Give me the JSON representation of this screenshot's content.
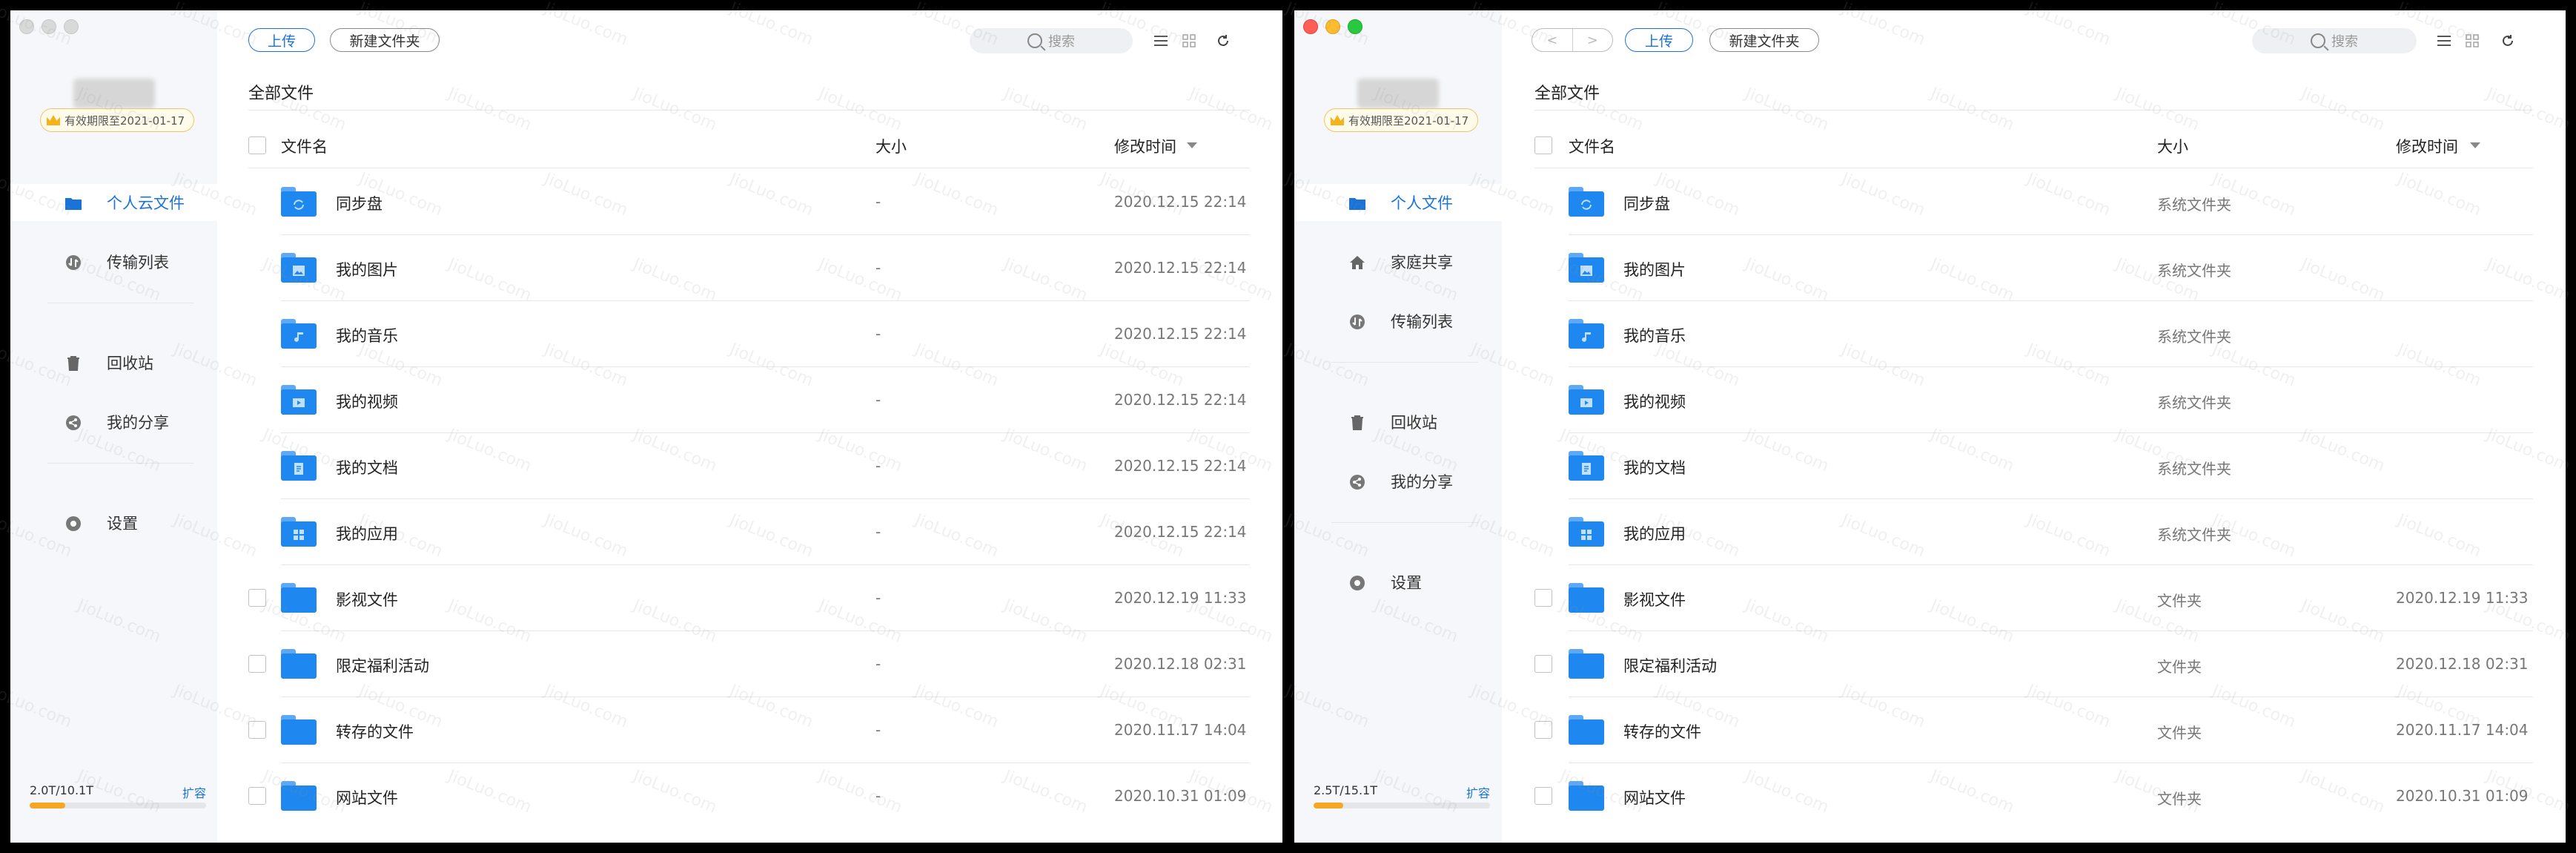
{
  "watermark": "JioLuo.com",
  "windows": [
    {
      "sidebar": {
        "vip_label": "有效期限至2021-01-17",
        "nav": [
          {
            "label": "个人云文件",
            "icon": "folder-icon",
            "active": true
          },
          {
            "label": "传输列表",
            "icon": "transfer-icon",
            "active": false
          },
          {
            "label": "回收站",
            "icon": "trash-icon",
            "active": false
          },
          {
            "label": "我的分享",
            "icon": "share-icon",
            "active": false
          },
          {
            "label": "设置",
            "icon": "gear-icon",
            "active": false
          }
        ],
        "storage": {
          "text": "2.0T/10.1T",
          "expand_label": "扩容",
          "used_fraction": 0.2
        }
      },
      "toolbar": {
        "upload_label": "上传",
        "new_folder_label": "新建文件夹",
        "search_placeholder": "搜索"
      },
      "breadcrumb": "全部文件",
      "table": {
        "headers": {
          "name": "文件名",
          "size": "大小",
          "modified": "修改时间"
        },
        "rows": [
          {
            "name": "同步盘",
            "size": "-",
            "modified": "2020.12.15 22:14",
            "glyph": "sync-icon",
            "checkbox": false
          },
          {
            "name": "我的图片",
            "size": "-",
            "modified": "2020.12.15 22:14",
            "glyph": "image-icon",
            "checkbox": false
          },
          {
            "name": "我的音乐",
            "size": "-",
            "modified": "2020.12.15 22:14",
            "glyph": "music-icon",
            "checkbox": false
          },
          {
            "name": "我的视频",
            "size": "-",
            "modified": "2020.12.15 22:14",
            "glyph": "video-icon",
            "checkbox": false
          },
          {
            "name": "我的文档",
            "size": "-",
            "modified": "2020.12.15 22:14",
            "glyph": "document-icon",
            "checkbox": false
          },
          {
            "name": "我的应用",
            "size": "-",
            "modified": "2020.12.15 22:14",
            "glyph": "apps-icon",
            "checkbox": false
          },
          {
            "name": "影视文件",
            "size": "-",
            "modified": "2020.12.19 11:33",
            "glyph": "",
            "checkbox": true
          },
          {
            "name": "限定福利活动",
            "size": "-",
            "modified": "2020.12.18 02:31",
            "glyph": "",
            "checkbox": true
          },
          {
            "name": "转存的文件",
            "size": "-",
            "modified": "2020.11.17 14:04",
            "glyph": "",
            "checkbox": true
          },
          {
            "name": "网站文件",
            "size": "-",
            "modified": "2020.10.31 01:09",
            "glyph": "",
            "checkbox": true
          }
        ]
      }
    },
    {
      "sidebar": {
        "vip_label": "有效期限至2021-01-17",
        "nav": [
          {
            "label": "个人文件",
            "icon": "folder-icon",
            "active": true
          },
          {
            "label": "家庭共享",
            "icon": "home-icon",
            "active": false
          },
          {
            "label": "传输列表",
            "icon": "transfer-icon",
            "active": false
          },
          {
            "label": "回收站",
            "icon": "trash-icon",
            "active": false
          },
          {
            "label": "我的分享",
            "icon": "share-icon",
            "active": false
          },
          {
            "label": "设置",
            "icon": "gear-icon",
            "active": false
          }
        ],
        "storage": {
          "text": "2.5T/15.1T",
          "expand_label": "扩容",
          "used_fraction": 0.17
        }
      },
      "toolbar": {
        "back": "<",
        "forward": ">",
        "upload_label": "上传",
        "new_folder_label": "新建文件夹",
        "search_placeholder": "搜索"
      },
      "breadcrumb": "全部文件",
      "table": {
        "headers": {
          "name": "文件名",
          "size": "大小",
          "modified": "修改时间"
        },
        "rows": [
          {
            "name": "同步盘",
            "size": "系统文件夹",
            "modified": "",
            "glyph": "sync-icon",
            "checkbox": false
          },
          {
            "name": "我的图片",
            "size": "系统文件夹",
            "modified": "",
            "glyph": "image-icon",
            "checkbox": false
          },
          {
            "name": "我的音乐",
            "size": "系统文件夹",
            "modified": "",
            "glyph": "music-icon",
            "checkbox": false
          },
          {
            "name": "我的视频",
            "size": "系统文件夹",
            "modified": "",
            "glyph": "video-icon",
            "checkbox": false
          },
          {
            "name": "我的文档",
            "size": "系统文件夹",
            "modified": "",
            "glyph": "document-icon",
            "checkbox": false
          },
          {
            "name": "我的应用",
            "size": "系统文件夹",
            "modified": "",
            "glyph": "apps-icon",
            "checkbox": false
          },
          {
            "name": "影视文件",
            "size": "文件夹",
            "modified": "2020.12.19 11:33",
            "glyph": "",
            "checkbox": true
          },
          {
            "name": "限定福利活动",
            "size": "文件夹",
            "modified": "2020.12.18 02:31",
            "glyph": "",
            "checkbox": true
          },
          {
            "name": "转存的文件",
            "size": "文件夹",
            "modified": "2020.11.17 14:04",
            "glyph": "",
            "checkbox": true
          },
          {
            "name": "网站文件",
            "size": "文件夹",
            "modified": "2020.10.31 01:09",
            "glyph": "",
            "checkbox": true
          }
        ]
      }
    }
  ],
  "colors": {
    "accent": "#1a73d9",
    "folder": "#1e87f0",
    "storage_fill": "#f5a623"
  }
}
